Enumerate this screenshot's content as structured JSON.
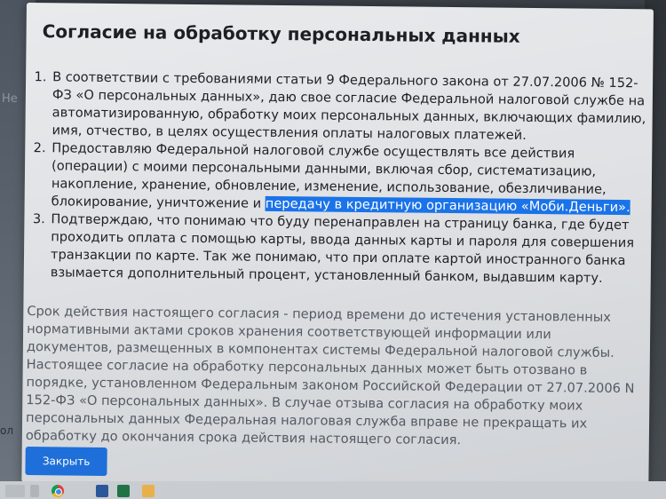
{
  "background": {
    "ghost_text_top": "Не",
    "ghost_text_bottom": "ол"
  },
  "modal": {
    "title": "Согласие на обработку персональных данных",
    "items": [
      "В соответствии с требованиями статьи 9 Федерального закона от 27.07.2006 № 152-ФЗ «О персональных данных», даю свое согласие Федеральной налоговой службе на автоматизированную, обработку моих персональных данных, включающих фамилию, имя, отчество, в целях осуществления оплаты налоговых платежей.",
      "Предоставляю Федеральной налоговой службе осуществлять все действия (операции) с моими персональными данными, включая сбор, систематизацию, накопление, хранение, обновление, изменение, использование, обезличивание, блокирование, уничтожение и",
      "Подтверждаю, что понимаю что буду перенаправлен на страницу банка, где будет проходить оплата с помощью карты, ввода данных карты и пароля для совершения транзакции по карте. Так же понимаю, что при оплате картой иностранного банка взымается дополнительный процент, установленный банком, выдавшим карту."
    ],
    "item2_highlight": "передачу в кредитную организацию «Моби.Деньги».",
    "note": "Срок действия настоящего согласия - период времени до истечения установленных нормативными актами сроков хранения соответствующей информации или документов, размещенных в компонентах системы Федеральной налоговой службы. Настоящее согласие на обработку персональных данных может быть отозвано в порядке, установленном Федеральным законом Российской Федерации от 27.07.2006 N 152-ФЗ «О персональных данных». В случае отзыва согласия на обработку моих персональных данных Федеральная налоговая служба вправе не прекращать их обработку до окончания срока действия настоящего согласия.",
    "close_label": "Закрыть"
  },
  "taskbar": {
    "icons": [
      "chrome-icon",
      "word-icon",
      "excel-icon",
      "file-explorer-icon"
    ],
    "colors": {
      "accent": "#1e6fd9",
      "highlight": "#1a73e8"
    }
  }
}
